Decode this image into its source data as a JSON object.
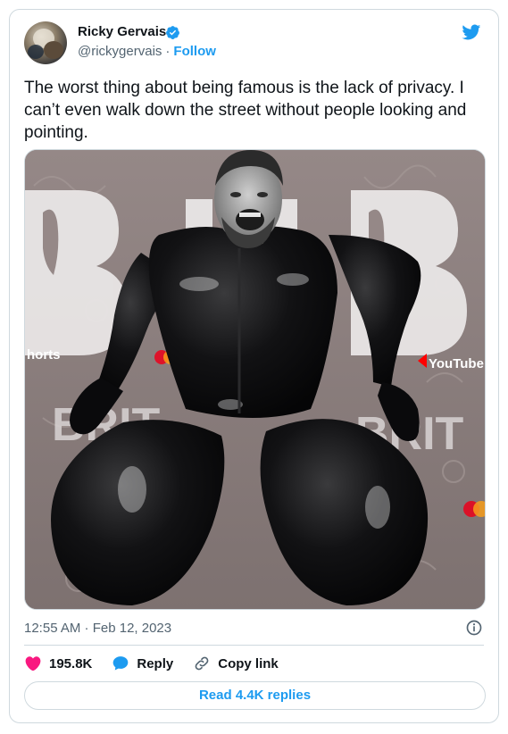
{
  "author": {
    "display_name": "Ricky Gervais",
    "handle": "@rickygervais",
    "separator": "·",
    "follow_label": "Follow",
    "verified": true
  },
  "tweet": {
    "text": "The worst thing about being famous is the lack of privacy. I can’t even walk down the street without people looking and pointing.",
    "timestamp": "12:55 AM · Feb 12, 2023"
  },
  "media": {
    "background_text_1": "BRIT",
    "background_text_2": "horts",
    "background_text_3": "YouTube",
    "background_text_4": "BRIT",
    "background_text_5": "BRIT"
  },
  "actions": {
    "like_count": "195.8K",
    "reply_label": "Reply",
    "copy_label": "Copy link"
  },
  "read_replies_label": "Read 4.4K replies",
  "colors": {
    "accent": "#1d9bf0",
    "like": "#f91880",
    "text": "#0f1419",
    "muted": "#536471",
    "border": "#cfd9de"
  },
  "icons": [
    "verified-badge-icon",
    "twitter-bird-icon",
    "info-icon",
    "heart-icon",
    "reply-bubble-icon",
    "link-icon"
  ]
}
